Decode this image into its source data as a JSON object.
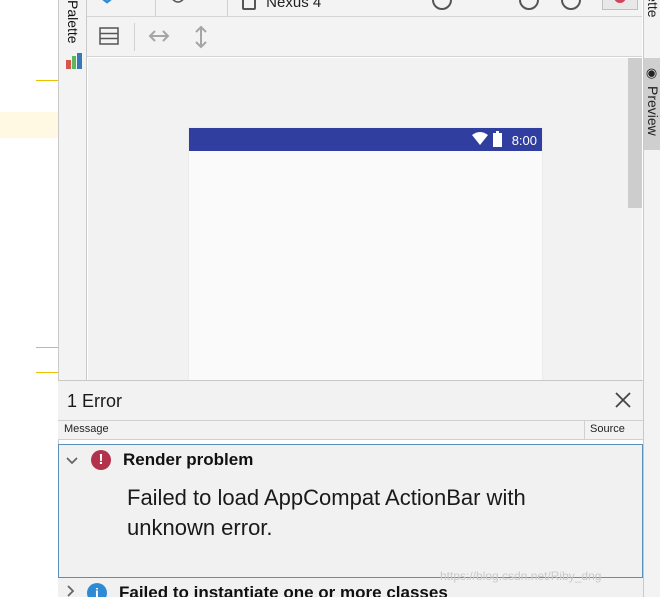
{
  "palette": {
    "label": "Palette"
  },
  "toolbar": {
    "device_label": "Nexus 4"
  },
  "device": {
    "status_time": "8:00"
  },
  "right_panel": {
    "top_label": "Palette",
    "preview_label": "Preview"
  },
  "error_panel": {
    "title": "1 Error",
    "columns": {
      "message": "Message",
      "source": "Source"
    },
    "items": [
      {
        "title": "Render problem",
        "body": "Failed to load AppCompat ActionBar with unknown error.",
        "severity": "error",
        "expanded": true
      },
      {
        "title": "Failed to instantiate one or more classes",
        "severity": "info",
        "expanded": false
      }
    ]
  },
  "watermark": "https://blog.csdn.net/Riby_dng",
  "colors": {
    "status_bar": "#303f9f",
    "error_icon": "#b3324b",
    "info_icon": "#2f8ad6",
    "selection_border": "#5b8fb9"
  }
}
